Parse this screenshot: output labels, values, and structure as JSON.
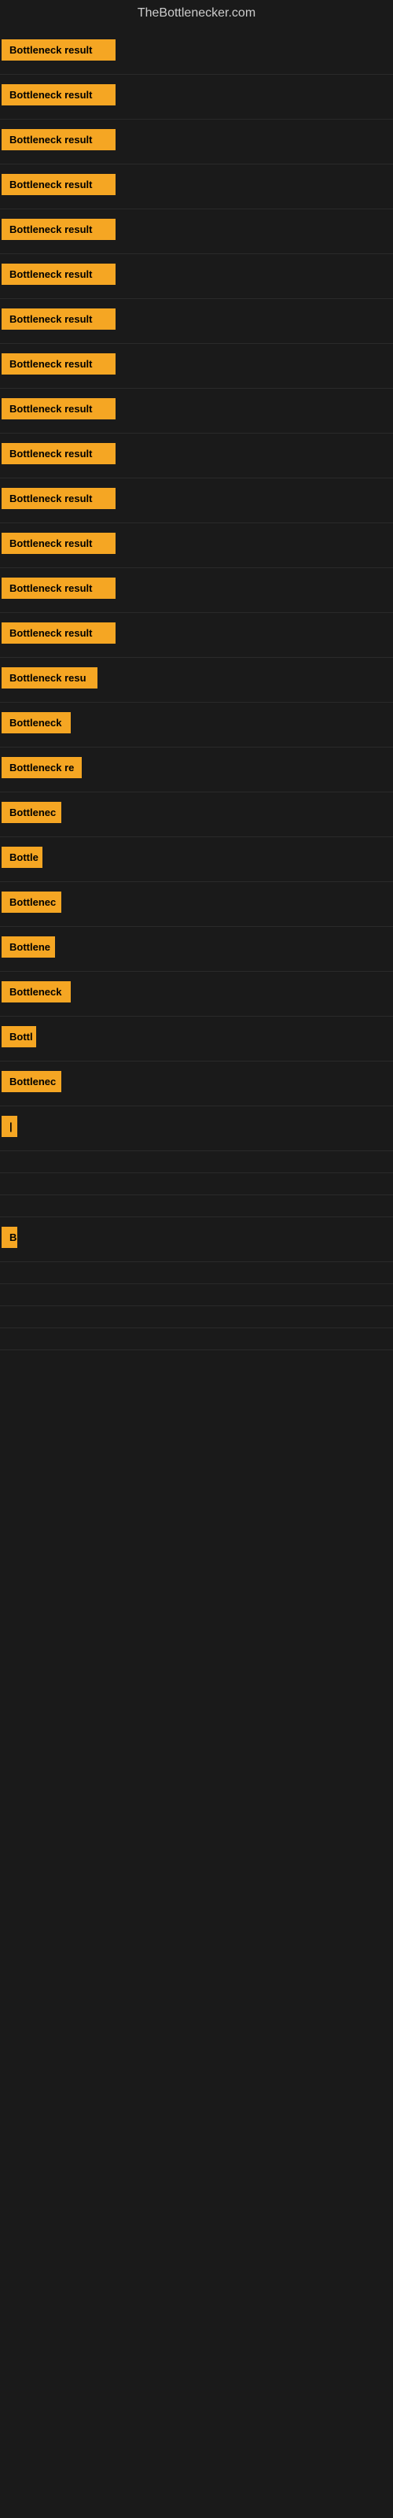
{
  "site": {
    "title": "TheBottlenecker.com"
  },
  "rows": [
    {
      "id": 1,
      "label": "Bottleneck result",
      "width": 145
    },
    {
      "id": 2,
      "label": "Bottleneck result",
      "width": 145
    },
    {
      "id": 3,
      "label": "Bottleneck result",
      "width": 145
    },
    {
      "id": 4,
      "label": "Bottleneck result",
      "width": 145
    },
    {
      "id": 5,
      "label": "Bottleneck result",
      "width": 145
    },
    {
      "id": 6,
      "label": "Bottleneck result",
      "width": 145
    },
    {
      "id": 7,
      "label": "Bottleneck result",
      "width": 145
    },
    {
      "id": 8,
      "label": "Bottleneck result",
      "width": 145
    },
    {
      "id": 9,
      "label": "Bottleneck result",
      "width": 145
    },
    {
      "id": 10,
      "label": "Bottleneck result",
      "width": 145
    },
    {
      "id": 11,
      "label": "Bottleneck result",
      "width": 145
    },
    {
      "id": 12,
      "label": "Bottleneck result",
      "width": 145
    },
    {
      "id": 13,
      "label": "Bottleneck result",
      "width": 145
    },
    {
      "id": 14,
      "label": "Bottleneck result",
      "width": 145
    },
    {
      "id": 15,
      "label": "Bottleneck resu",
      "width": 122
    },
    {
      "id": 16,
      "label": "Bottleneck",
      "width": 88
    },
    {
      "id": 17,
      "label": "Bottleneck re",
      "width": 102
    },
    {
      "id": 18,
      "label": "Bottlenec",
      "width": 76
    },
    {
      "id": 19,
      "label": "Bottle",
      "width": 52
    },
    {
      "id": 20,
      "label": "Bottlenec",
      "width": 76
    },
    {
      "id": 21,
      "label": "Bottlene",
      "width": 68
    },
    {
      "id": 22,
      "label": "Bottleneck",
      "width": 88
    },
    {
      "id": 23,
      "label": "Bottl",
      "width": 44
    },
    {
      "id": 24,
      "label": "Bottlenec",
      "width": 76
    },
    {
      "id": 25,
      "label": "|",
      "width": 14
    },
    {
      "id": 26,
      "label": "",
      "width": 0
    },
    {
      "id": 27,
      "label": "",
      "width": 0
    },
    {
      "id": 28,
      "label": "",
      "width": 0
    },
    {
      "id": 29,
      "label": "B",
      "width": 14
    },
    {
      "id": 30,
      "label": "",
      "width": 0
    },
    {
      "id": 31,
      "label": "",
      "width": 0
    },
    {
      "id": 32,
      "label": "",
      "width": 0
    },
    {
      "id": 33,
      "label": "",
      "width": 0
    }
  ]
}
